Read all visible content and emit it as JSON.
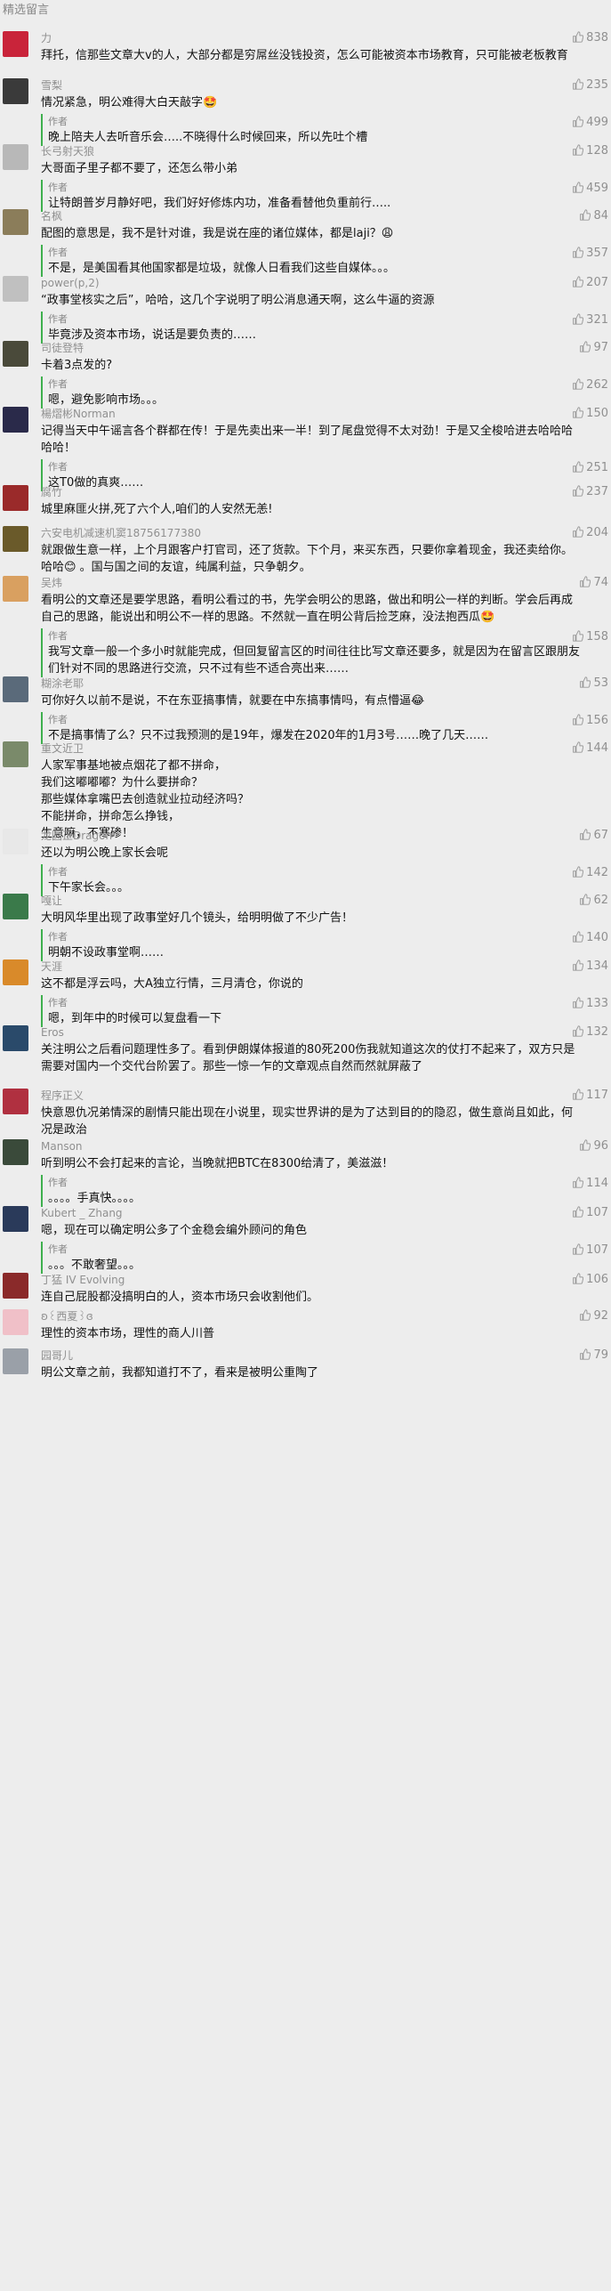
{
  "header": {
    "title": "精选留言"
  },
  "comments": [
    {
      "nick": "力",
      "text": "拜托，信那些文章大v的人，大部分都是穷屌丝没钱投资，怎么可能被资本市场教育，只可能被老板教育",
      "likes": "838",
      "color": "#c9243a",
      "reply": null
    },
    {
      "nick": "雪梨",
      "text": "情况紧急，明公难得大白天敲字🤩",
      "likes": "235",
      "color": "#3a3a3a",
      "reply": {
        "tag": "作者",
        "text": "晚上陪夫人去听音乐会…..不晓得什么时候回来，所以先吐个槽",
        "likes": "499"
      }
    },
    {
      "nick": "长弓射天狼",
      "text": "大哥面子里子都不要了，还怎么带小弟",
      "likes": "128",
      "color": "#b8b8b8",
      "reply": {
        "tag": "作者",
        "text": "让特朗普岁月静好吧，我们好好修炼内功，准备看替他负重前行…..",
        "likes": "459"
      }
    },
    {
      "nick": "名枫",
      "text": "配图的意思是，我不是针对谁，我是说在座的诸位媒体，都是laji？😩",
      "likes": "84",
      "color": "#8b7d5a",
      "reply": {
        "tag": "作者",
        "text": "不是，是美国看其他国家都是垃圾，就像人日看我们这些自媒体。。。",
        "likes": "357"
      }
    },
    {
      "nick": "power(p,2)",
      "text": "“政事堂核实之后”，哈哈，这几个字说明了明公消息通天啊，这么牛逼的资源",
      "likes": "207",
      "color": "#c0c0c0",
      "reply": {
        "tag": "作者",
        "text": "毕竟涉及资本市场，说话是要负责的……",
        "likes": "321"
      }
    },
    {
      "nick": "司徒登特",
      "text": "卡着3点发的?",
      "likes": "97",
      "color": "#4a4a3a",
      "reply": {
        "tag": "作者",
        "text": "嗯，避免影响市场。。。",
        "likes": "262"
      }
    },
    {
      "nick": "楊熠彬Norman",
      "text": "记得当天中午谣言各个群都在传！于是先卖出来一半！到了尾盘觉得不太对劲！于是又全梭哈进去哈哈哈哈哈！",
      "likes": "150",
      "color": "#2a2a4a",
      "reply": {
        "tag": "作者",
        "text": "这T0做的真爽……",
        "likes": "251"
      }
    },
    {
      "nick": "腐竹",
      "text": "城里麻匪火拼,死了六个人,咱们的人安然无恙!",
      "likes": "237",
      "color": "#9a2a2a",
      "reply": null
    },
    {
      "nick": "六安电机减速机窦18756177380",
      "text": "就跟做生意一样，上个月跟客户打官司，还了货款。下个月，来买东西，只要你拿着现金，我还卖给你。哈哈😊 。国与国之间的友谊，纯属利益，只争朝夕。",
      "likes": "204",
      "color": "#6a5a2a",
      "reply": null
    },
    {
      "nick": "吴炜",
      "text": "看明公的文章还是要学思路，看明公看过的书，先学会明公的思路，做出和明公一样的判断。学会后再成自己的思路，能说出和明公不一样的思路。不然就一直在明公背后捡芝麻，没法抱西瓜🤩",
      "likes": "74",
      "color": "#d9a060",
      "reply": {
        "tag": "作者",
        "text": "我写文章一般一个多小时就能完成，但回复留言区的时间往往比写文章还要多，就是因为在留言区跟朋友们针对不同的思路进行交流，只不过有些不适合亮出来……",
        "likes": "158"
      }
    },
    {
      "nick": "糊涂老耶",
      "text": "可你好久以前不是说，不在东亚搞事情，就要在中东搞事情吗，有点懵逼😂",
      "likes": "53",
      "color": "#5a6a7a",
      "reply": {
        "tag": "作者",
        "text": "不是搞事情了么？只不过我预测的是19年，爆发在2020年的1月3号……晚了几天……",
        "likes": "156"
      }
    },
    {
      "nick": "重文近卫",
      "text": "人家军事基地被点烟花了都不拼命，\n我们这嘟嘟嘟？为什么要拼命？\n那些媒体拿嘴巴去创造就业拉动经济吗？\n不能拼命，拼命怎么挣钱，\n生意嘛，不寒碜！",
      "likes": "144",
      "color": "#7a8a6a",
      "reply": null
    },
    {
      "nick": "龙圆正Dragon",
      "text": "还以为明公晚上家长会呢",
      "likes": "67",
      "color": "#e8e8e8",
      "reply": {
        "tag": "作者",
        "text": "下午家长会。。。",
        "likes": "142"
      }
    },
    {
      "nick": "嘎让",
      "text": "大明风华里出现了政事堂好几个镜头，给明明做了不少广告！",
      "likes": "62",
      "color": "#3a7a4a",
      "reply": {
        "tag": "作者",
        "text": "明朝不设政事堂啊……",
        "likes": "140"
      }
    },
    {
      "nick": "天涯",
      "text": "这不都是浮云吗，大A独立行情，三月清仓，你说的",
      "likes": "134",
      "color": "#d98a2a",
      "reply": {
        "tag": "作者",
        "text": "嗯，到年中的时候可以复盘看一下",
        "likes": "133"
      }
    },
    {
      "nick": "Eros",
      "text": "关注明公之后看问题理性多了。看到伊朗媒体报道的80死200伤我就知道这次的仗打不起来了，双方只是需要对国内一个交代台阶罢了。那些一惊一乍的文章观点自然而然就屏蔽了",
      "likes": "132",
      "color": "#2a4a6a",
      "reply": null
    },
    {
      "nick": "程序正义",
      "text": "快意恩仇况弟情深的剧情只能出现在小说里，现实世界讲的是为了达到目的的隐忍，做生意尚且如此，何况是政治",
      "likes": "117",
      "color": "#b03040",
      "reply": null
    },
    {
      "nick": "Manson",
      "text": "听到明公不会打起来的言论，当晚就把BTC在8300给清了，美滋滋！",
      "likes": "96",
      "color": "#3a4a3a",
      "reply": {
        "tag": "作者",
        "text": "。。。。手真快。。。。",
        "likes": "114"
      }
    },
    {
      "nick": "Kubert _ Zhang",
      "text": "嗯，现在可以确定明公多了个金稳会编外顾问的角色",
      "likes": "107",
      "color": "#2a3a5a",
      "reply": {
        "tag": "作者",
        "text": "。。。不敢奢望。。。",
        "likes": "107"
      }
    },
    {
      "nick": "丁猛 IV Evolving",
      "text": "连自己屁股都没搞明白的人，资本市场只会收割他们。",
      "likes": "106",
      "color": "#8a2a2a",
      "reply": null
    },
    {
      "nick": "ʚ꒰西夏꒱ɞ",
      "text": "理性的资本市场，理性的商人川普",
      "likes": "92",
      "color": "#f0c0c8",
      "reply": null
    },
    {
      "nick": "园哥儿",
      "text": "明公文章之前，我都知道打不了，看来是被明公重陶了",
      "likes": "79",
      "color": "#9aa0a8",
      "reply": null
    }
  ]
}
